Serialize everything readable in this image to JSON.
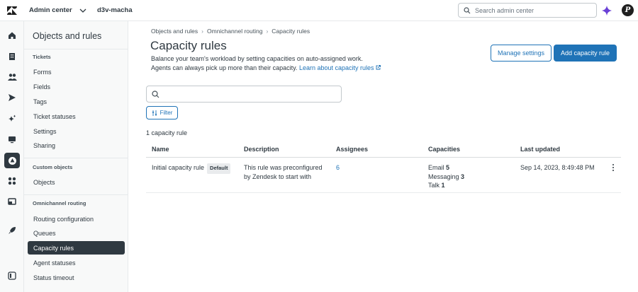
{
  "topbar": {
    "product": "Admin center",
    "account": "d3v-macha",
    "search_placeholder": "Search admin center",
    "avatar_initial": "P"
  },
  "rail": {
    "icons": [
      "home-icon",
      "building-icon",
      "people-icon",
      "send-icon",
      "sparkle-icon",
      "monitor-icon",
      "objects-icon",
      "apps-icon",
      "workspace-icon",
      "rocket-icon",
      "collapse-icon"
    ]
  },
  "nav": {
    "title": "Objects and rules",
    "sections": [
      {
        "label": "Tickets",
        "items": [
          "Forms",
          "Fields",
          "Tags",
          "Ticket statuses",
          "Settings",
          "Sharing"
        ]
      },
      {
        "label": "Custom objects",
        "items": [
          "Objects"
        ]
      },
      {
        "label": "Omnichannel routing",
        "items": [
          "Routing configuration",
          "Queues",
          "Capacity rules",
          "Agent statuses",
          "Status timeout"
        ]
      }
    ],
    "active_item": "Capacity rules"
  },
  "breadcrumb": [
    "Objects and rules",
    "Omnichannel routing",
    "Capacity rules"
  ],
  "page": {
    "title": "Capacity rules",
    "description_line1": "Balance your team's workload by setting capacities on auto-assigned work.",
    "description_line2": "Agents can always pick up more than their capacity.",
    "learn_more": "Learn about capacity rules",
    "manage_settings": "Manage settings",
    "add_rule": "Add capacity rule",
    "filter": "Filter",
    "count": "1 capacity rule"
  },
  "table": {
    "columns": [
      "Name",
      "Description",
      "Assignees",
      "Capacities",
      "Last updated"
    ],
    "rows": [
      {
        "name": "Initial capacity rule",
        "badge": "Default",
        "description_line1": "This rule was preconfigured",
        "description_line2": "by Zendesk to start with",
        "assignees": "6",
        "capacities": [
          {
            "label": "Email",
            "value": "5"
          },
          {
            "label": "Messaging",
            "value": "3"
          },
          {
            "label": "Talk",
            "value": "1"
          }
        ],
        "last_updated": "Sep 14, 2023, 8:49:48 PM"
      }
    ]
  },
  "colors": {
    "accent": "#1f73b7",
    "text": "#2f3941",
    "nav_bg": "#f8f9f9",
    "active": "#2f3941"
  }
}
